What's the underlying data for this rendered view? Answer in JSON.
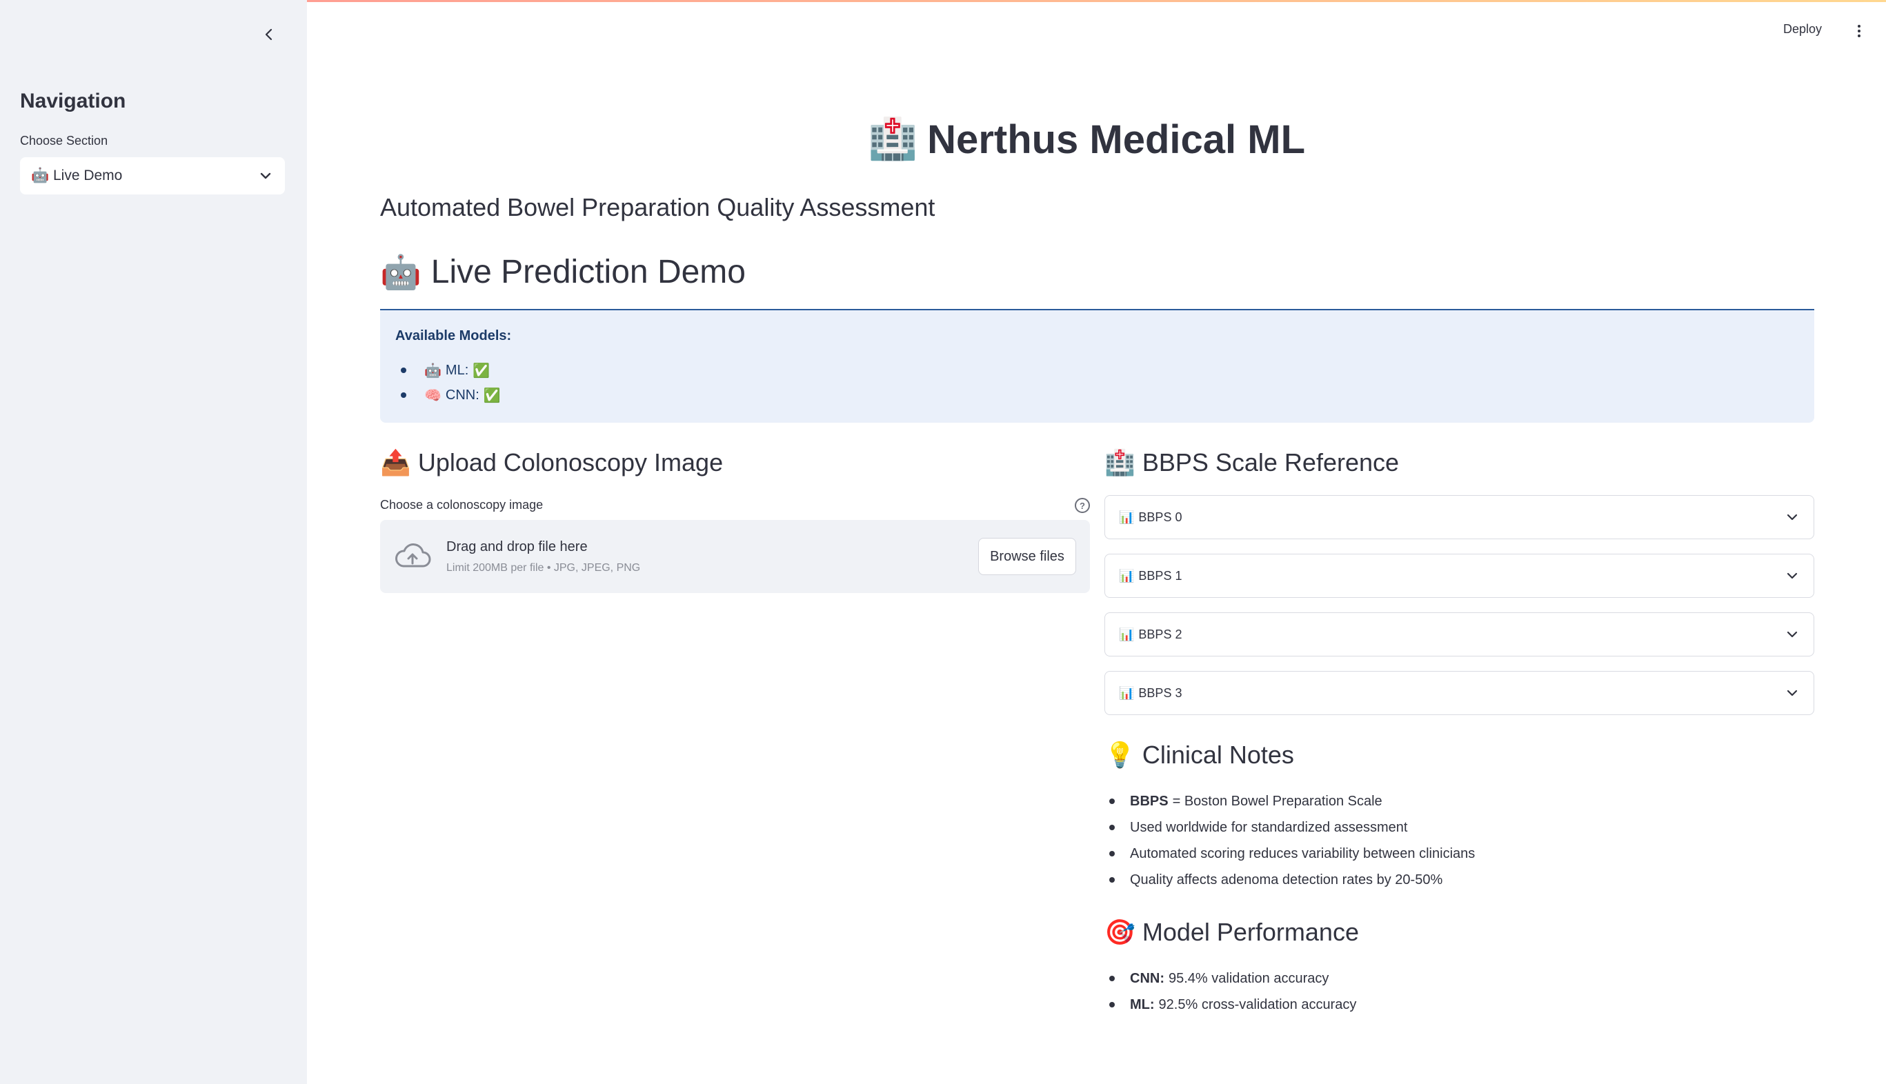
{
  "sidebar": {
    "title": "Navigation",
    "select_label": "Choose Section",
    "select_value": "🤖 Live Demo"
  },
  "topbar": {
    "deploy": "Deploy"
  },
  "app": {
    "title_icon": "🏥",
    "title": "Nerthus Medical ML",
    "subtitle": "Automated Bowel Preparation Quality Assessment",
    "section_icon": "🤖",
    "section_title": "Live Prediction Demo"
  },
  "models": {
    "heading": "Available Models:",
    "items": [
      {
        "icon": "🤖",
        "label": "ML:",
        "status": "✅"
      },
      {
        "icon": "🧠",
        "label": "CNN:",
        "status": "✅"
      }
    ]
  },
  "upload": {
    "icon": "📤",
    "heading": "Upload Colonoscopy Image",
    "label": "Choose a colonoscopy image",
    "help": "?",
    "drop_text": "Drag and drop file here",
    "limit_text": "Limit 200MB per file • JPG, JPEG, PNG",
    "browse": "Browse files"
  },
  "bbps": {
    "icon": "🏥",
    "heading": "BBPS Scale Reference",
    "item_icon": "📊",
    "items": [
      "BBPS 0",
      "BBPS 1",
      "BBPS 2",
      "BBPS 3"
    ]
  },
  "clinical": {
    "icon": "💡",
    "heading": "Clinical Notes",
    "items": [
      {
        "bold": "BBPS",
        "text": "= Boston Bowel Preparation Scale"
      },
      {
        "bold": "",
        "text": "Used worldwide for standardized assessment"
      },
      {
        "bold": "",
        "text": "Automated scoring reduces variability between clinicians"
      },
      {
        "bold": "",
        "text": "Quality affects adenoma detection rates by 20-50%"
      }
    ]
  },
  "performance": {
    "icon": "🎯",
    "heading": "Model Performance",
    "items": [
      {
        "bold": "CNN:",
        "text": "95.4% validation accuracy"
      },
      {
        "bold": "ML:",
        "text": "92.5% cross-validation accuracy"
      }
    ]
  }
}
